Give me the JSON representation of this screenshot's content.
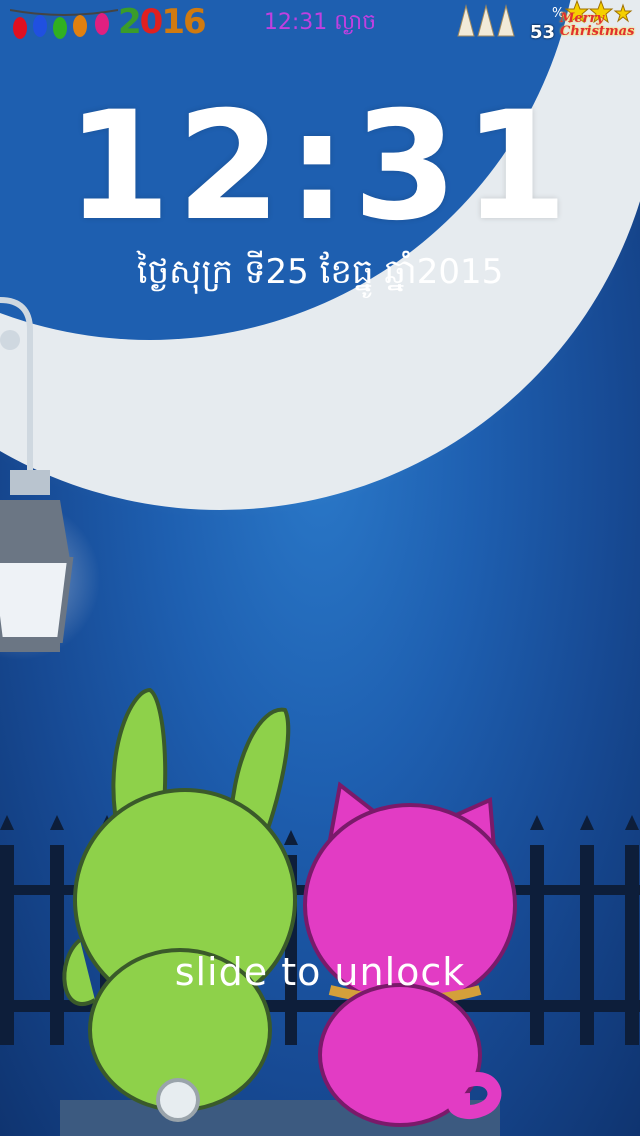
{
  "status_bar": {
    "year": [
      "2",
      "0",
      "1",
      "6"
    ],
    "year_colors": [
      "#3a9c2a",
      "#e02020",
      "#d07a10",
      "#d07a10"
    ],
    "time": "12:31 ល្ងាច",
    "battery_percent": "53",
    "percent_sign": "%",
    "greeting": "Merry Christmas",
    "icons": [
      "christmas-lights-icon",
      "christmas-tree-icon",
      "star-icon"
    ]
  },
  "lockscreen": {
    "clock": "12:31",
    "date": "ថ្ងៃសុក្រ ទី25 ខែធ្នូ ឆ្នាំ2015",
    "unlock_hint": "slide to unlock"
  },
  "colors": {
    "sky": "#1e5fb0",
    "moon": "#e6ebef",
    "green_bunny": "#8ed14a",
    "pink_cat": "#e23cc4",
    "clock_text": "#ffffff",
    "status_time": "#c040e0"
  }
}
